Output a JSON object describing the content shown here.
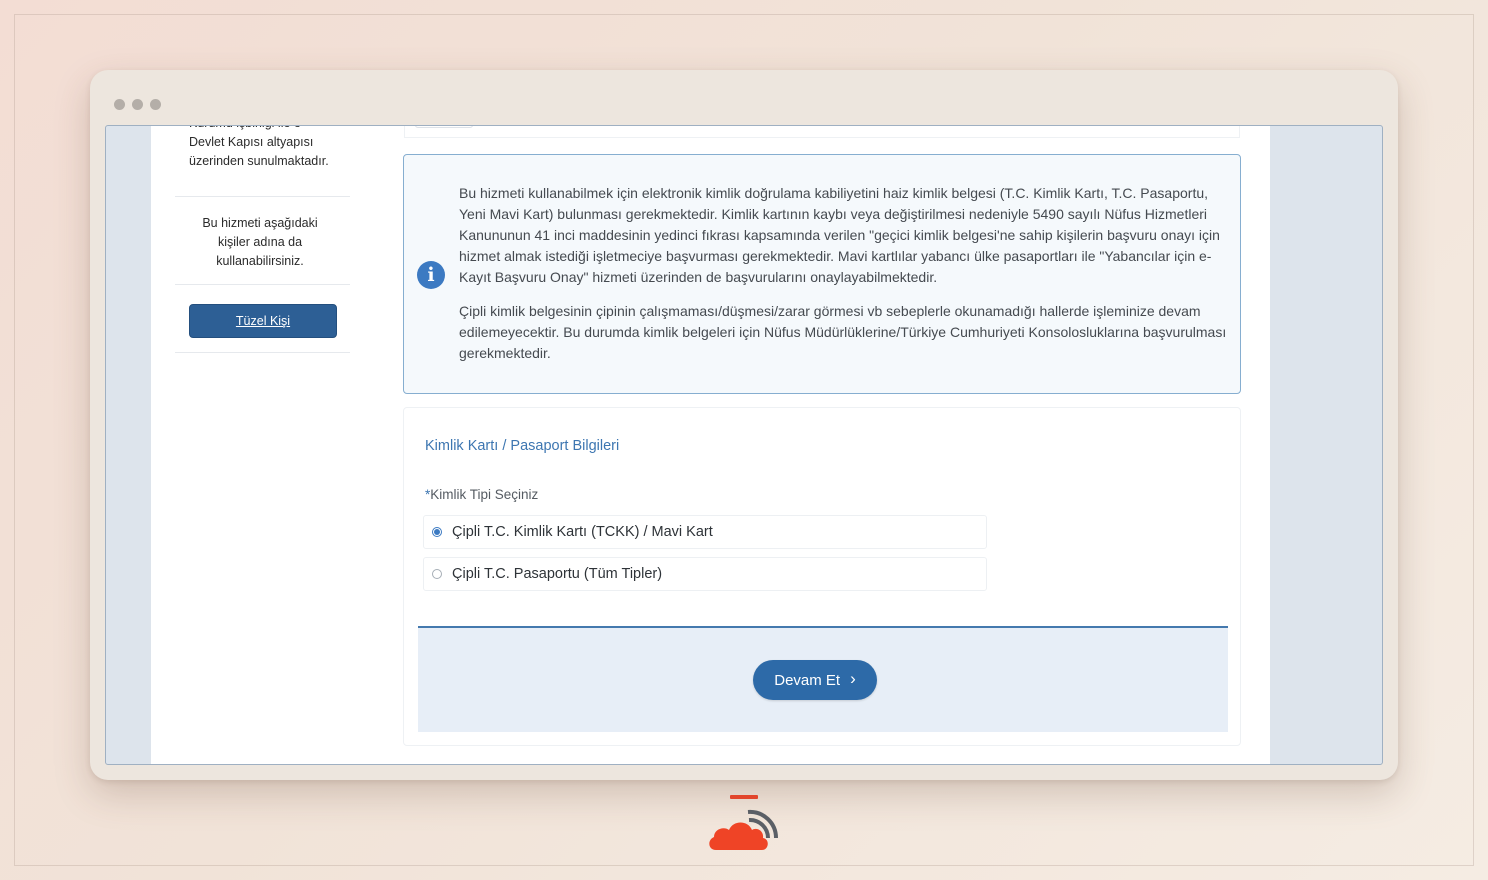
{
  "window": {
    "accent": "#2d6aa8",
    "info_border": "#86aed0"
  },
  "left_panel": {
    "text_top": "Kurumu işbirliği ile e-Devlet Kapısı altyapısı üzerinden sunulmaktadır.",
    "text_bottom": "Bu hizmeti aşağıdaki kişiler adına da kullanabilirsiniz.",
    "tuzel_label": "Tüzel Kişi"
  },
  "info": {
    "icon": "info-icon",
    "paragraph1": "Bu hizmeti kullanabilmek için elektronik kimlik doğrulama kabiliyetini haiz kimlik belgesi (T.C. Kimlik Kartı, T.C. Pasaportu, Yeni Mavi Kart) bulunması gerekmektedir. Kimlik kartının kaybı veya değiştirilmesi nedeniyle 5490 sayılı Nüfus Hizmetleri Kanununun 41 inci maddesinin yedinci fıkrası kapsamında verilen \"geçici kimlik belgesi'ne sahip kişilerin başvuru onayı için hizmet almak istediği işletmeciye başvurması gerekmektedir. Mavi kartlılar yabancı ülke pasaportları ile \"Yabancılar için e-Kayıt Başvuru Onay\" hizmeti üzerinden de başvurularını onaylayabilmektedir.",
    "paragraph2": "Çipli kimlik belgesinin çipinin çalışmaması/düşmesi/zarar görmesi vb sebeplerle okunamadığı hallerde işleminize devam edilemeyecektir. Bu durumda kimlik belgeleri için Nüfus Müdürlüklerine/Türkiye Cumhuriyeti Konsolosluklarına başvurulması gerekmektedir."
  },
  "form": {
    "section_title": "Kimlik Kartı / Pasaport Bilgileri",
    "required_mark": "*",
    "field_label": "Kimlik Tipi Seçiniz",
    "options": [
      {
        "label": "Çipli T.C. Kimlik Kartı (TCKK) / Mavi Kart",
        "selected": true
      },
      {
        "label": "Çipli T.C. Pasaportu (Tüm Tipler)",
        "selected": false
      }
    ],
    "submit_label": "Devam Et",
    "submit_icon": "chevron-right-icon"
  }
}
